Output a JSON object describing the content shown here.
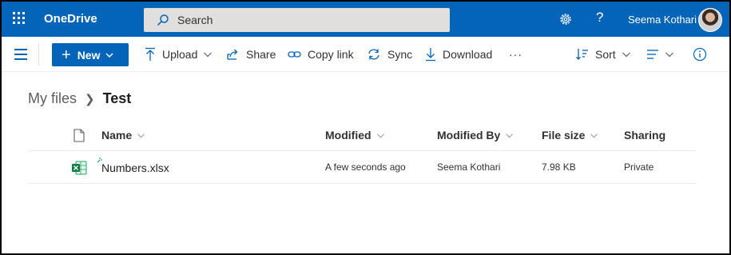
{
  "suitebar": {
    "app_name": "OneDrive",
    "search_placeholder": "Search",
    "user_name": "Seema Kothari",
    "brand_color": "#0364b8"
  },
  "commandbar": {
    "new_label": "New",
    "commands": {
      "upload": "Upload",
      "share": "Share",
      "copy_link": "Copy link",
      "sync": "Sync",
      "download": "Download",
      "more": "···",
      "sort": "Sort"
    },
    "icons": [
      "hamburger-icon",
      "upload-icon",
      "share-icon",
      "link-icon",
      "sync-icon",
      "download-icon",
      "sort-icon",
      "view-icon",
      "info-icon"
    ]
  },
  "breadcrumb": {
    "root": "My files",
    "current": "Test"
  },
  "list": {
    "columns": {
      "name": "Name",
      "modified": "Modified",
      "modified_by": "Modified By",
      "file_size": "File size",
      "sharing": "Sharing"
    },
    "rows": [
      {
        "name": "Numbers.xlsx",
        "modified": "A few seconds ago",
        "modified_by": "Seema Kothari",
        "file_size": "7.98 KB",
        "sharing": "Private",
        "icon": "excel-file-icon"
      }
    ]
  }
}
